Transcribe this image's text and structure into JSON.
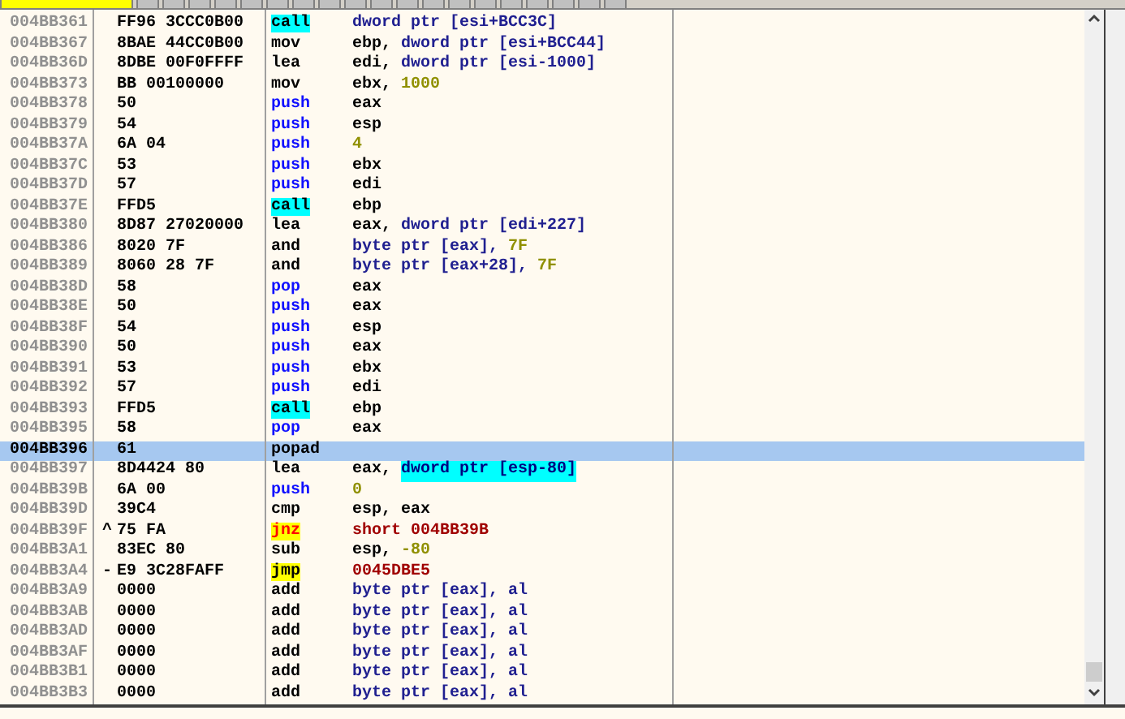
{
  "rows": [
    {
      "address": "004BB361",
      "hex": "FF96 3CCC0B00",
      "mnemonic": {
        "text": "call",
        "kind": "call"
      },
      "operands": [
        {
          "text": "dword ptr [esi+BCC3C]",
          "kind": "mem"
        }
      ],
      "selected": false
    },
    {
      "address": "004BB367",
      "hex": "8BAE 44CC0B00",
      "mnemonic": {
        "text": "mov",
        "kind": "plain"
      },
      "operands": [
        {
          "text": "ebp, ",
          "kind": "plain"
        },
        {
          "text": "dword ptr [esi+BCC44]",
          "kind": "mem"
        }
      ],
      "selected": false
    },
    {
      "address": "004BB36D",
      "hex": "8DBE 00F0FFFF",
      "mnemonic": {
        "text": "lea",
        "kind": "plain"
      },
      "operands": [
        {
          "text": "edi, ",
          "kind": "plain"
        },
        {
          "text": "dword ptr [esi-1000]",
          "kind": "mem"
        }
      ],
      "selected": false
    },
    {
      "address": "004BB373",
      "hex": "BB 00100000",
      "mnemonic": {
        "text": "mov",
        "kind": "plain"
      },
      "operands": [
        {
          "text": "ebx, ",
          "kind": "plain"
        },
        {
          "text": "1000",
          "kind": "const"
        }
      ],
      "selected": false
    },
    {
      "address": "004BB378",
      "hex": "50",
      "mnemonic": {
        "text": "push",
        "kind": "stack"
      },
      "operands": [
        {
          "text": "eax",
          "kind": "plain"
        }
      ],
      "selected": false
    },
    {
      "address": "004BB379",
      "hex": "54",
      "mnemonic": {
        "text": "push",
        "kind": "stack"
      },
      "operands": [
        {
          "text": "esp",
          "kind": "plain"
        }
      ],
      "selected": false
    },
    {
      "address": "004BB37A",
      "hex": "6A 04",
      "mnemonic": {
        "text": "push",
        "kind": "stack"
      },
      "operands": [
        {
          "text": "4",
          "kind": "const"
        }
      ],
      "selected": false
    },
    {
      "address": "004BB37C",
      "hex": "53",
      "mnemonic": {
        "text": "push",
        "kind": "stack"
      },
      "operands": [
        {
          "text": "ebx",
          "kind": "plain"
        }
      ],
      "selected": false
    },
    {
      "address": "004BB37D",
      "hex": "57",
      "mnemonic": {
        "text": "push",
        "kind": "stack"
      },
      "operands": [
        {
          "text": "edi",
          "kind": "plain"
        }
      ],
      "selected": false
    },
    {
      "address": "004BB37E",
      "hex": "FFD5",
      "mnemonic": {
        "text": "call",
        "kind": "call"
      },
      "operands": [
        {
          "text": "ebp",
          "kind": "plain"
        }
      ],
      "selected": false
    },
    {
      "address": "004BB380",
      "hex": "8D87 27020000",
      "mnemonic": {
        "text": "lea",
        "kind": "plain"
      },
      "operands": [
        {
          "text": "eax, ",
          "kind": "plain"
        },
        {
          "text": "dword ptr [edi+227]",
          "kind": "mem"
        }
      ],
      "selected": false
    },
    {
      "address": "004BB386",
      "hex": "8020 7F",
      "mnemonic": {
        "text": "and",
        "kind": "plain"
      },
      "operands": [
        {
          "text": "byte ptr [eax], ",
          "kind": "mem"
        },
        {
          "text": "7F",
          "kind": "const"
        }
      ],
      "selected": false
    },
    {
      "address": "004BB389",
      "hex": "8060 28 7F",
      "mnemonic": {
        "text": "and",
        "kind": "plain"
      },
      "operands": [
        {
          "text": "byte ptr [eax+28], ",
          "kind": "mem"
        },
        {
          "text": "7F",
          "kind": "const"
        }
      ],
      "selected": false
    },
    {
      "address": "004BB38D",
      "hex": "58",
      "mnemonic": {
        "text": "pop",
        "kind": "stack"
      },
      "operands": [
        {
          "text": "eax",
          "kind": "plain"
        }
      ],
      "selected": false
    },
    {
      "address": "004BB38E",
      "hex": "50",
      "mnemonic": {
        "text": "push",
        "kind": "stack"
      },
      "operands": [
        {
          "text": "eax",
          "kind": "plain"
        }
      ],
      "selected": false
    },
    {
      "address": "004BB38F",
      "hex": "54",
      "mnemonic": {
        "text": "push",
        "kind": "stack"
      },
      "operands": [
        {
          "text": "esp",
          "kind": "plain"
        }
      ],
      "selected": false
    },
    {
      "address": "004BB390",
      "hex": "50",
      "mnemonic": {
        "text": "push",
        "kind": "stack"
      },
      "operands": [
        {
          "text": "eax",
          "kind": "plain"
        }
      ],
      "selected": false
    },
    {
      "address": "004BB391",
      "hex": "53",
      "mnemonic": {
        "text": "push",
        "kind": "stack"
      },
      "operands": [
        {
          "text": "ebx",
          "kind": "plain"
        }
      ],
      "selected": false
    },
    {
      "address": "004BB392",
      "hex": "57",
      "mnemonic": {
        "text": "push",
        "kind": "stack"
      },
      "operands": [
        {
          "text": "edi",
          "kind": "plain"
        }
      ],
      "selected": false
    },
    {
      "address": "004BB393",
      "hex": "FFD5",
      "mnemonic": {
        "text": "call",
        "kind": "call"
      },
      "operands": [
        {
          "text": "ebp",
          "kind": "plain"
        }
      ],
      "selected": false
    },
    {
      "address": "004BB395",
      "hex": "58",
      "mnemonic": {
        "text": "pop",
        "kind": "stack"
      },
      "operands": [
        {
          "text": "eax",
          "kind": "plain"
        }
      ],
      "selected": false
    },
    {
      "address": "004BB396",
      "hex": "61",
      "mnemonic": {
        "text": "popad",
        "kind": "plain"
      },
      "operands": [],
      "selected": true
    },
    {
      "address": "004BB397",
      "hex": "8D4424 80",
      "mnemonic": {
        "text": "lea",
        "kind": "plain"
      },
      "operands": [
        {
          "text": "eax, ",
          "kind": "plain"
        },
        {
          "text": "dword ptr [esp-80]",
          "kind": "mem_hl"
        }
      ],
      "selected": false
    },
    {
      "address": "004BB39B",
      "hex": "6A 00",
      "mnemonic": {
        "text": "push",
        "kind": "stack"
      },
      "operands": [
        {
          "text": "0",
          "kind": "const"
        }
      ],
      "selected": false
    },
    {
      "address": "004BB39D",
      "hex": "39C4",
      "mnemonic": {
        "text": "cmp",
        "kind": "plain"
      },
      "operands": [
        {
          "text": "esp, eax",
          "kind": "plain"
        }
      ],
      "selected": false
    },
    {
      "address": "004BB39F",
      "jump_mark": "^",
      "hex": "75 FA",
      "mnemonic": {
        "text": "jnz",
        "kind": "jcc"
      },
      "operands": [
        {
          "text": "short 004BB39B",
          "kind": "target"
        }
      ],
      "selected": false
    },
    {
      "address": "004BB3A1",
      "hex": "83EC 80",
      "mnemonic": {
        "text": "sub",
        "kind": "plain"
      },
      "operands": [
        {
          "text": "esp, ",
          "kind": "plain"
        },
        {
          "text": "-80",
          "kind": "const"
        }
      ],
      "selected": false
    },
    {
      "address": "004BB3A4",
      "jump_mark": "-",
      "hex": "E9 3C28FAFF",
      "mnemonic": {
        "text": "jmp",
        "kind": "jmp"
      },
      "operands": [
        {
          "text": "0045DBE5",
          "kind": "target"
        }
      ],
      "selected": false
    },
    {
      "address": "004BB3A9",
      "hex": "0000",
      "mnemonic": {
        "text": "add",
        "kind": "plain"
      },
      "operands": [
        {
          "text": "byte ptr [eax], al",
          "kind": "mem"
        }
      ],
      "selected": false
    },
    {
      "address": "004BB3AB",
      "hex": "0000",
      "mnemonic": {
        "text": "add",
        "kind": "plain"
      },
      "operands": [
        {
          "text": "byte ptr [eax], al",
          "kind": "mem"
        }
      ],
      "selected": false
    },
    {
      "address": "004BB3AD",
      "hex": "0000",
      "mnemonic": {
        "text": "add",
        "kind": "plain"
      },
      "operands": [
        {
          "text": "byte ptr [eax], al",
          "kind": "mem"
        }
      ],
      "selected": false
    },
    {
      "address": "004BB3AF",
      "hex": "0000",
      "mnemonic": {
        "text": "add",
        "kind": "plain"
      },
      "operands": [
        {
          "text": "byte ptr [eax], al",
          "kind": "mem"
        }
      ],
      "selected": false
    },
    {
      "address": "004BB3B1",
      "hex": "0000",
      "mnemonic": {
        "text": "add",
        "kind": "plain"
      },
      "operands": [
        {
          "text": "byte ptr [eax], al",
          "kind": "mem"
        }
      ],
      "selected": false
    },
    {
      "address": "004BB3B3",
      "hex": "0000",
      "mnemonic": {
        "text": "add",
        "kind": "plain"
      },
      "operands": [
        {
          "text": "byte ptr [eax], al",
          "kind": "mem"
        }
      ],
      "selected": false
    }
  ]
}
